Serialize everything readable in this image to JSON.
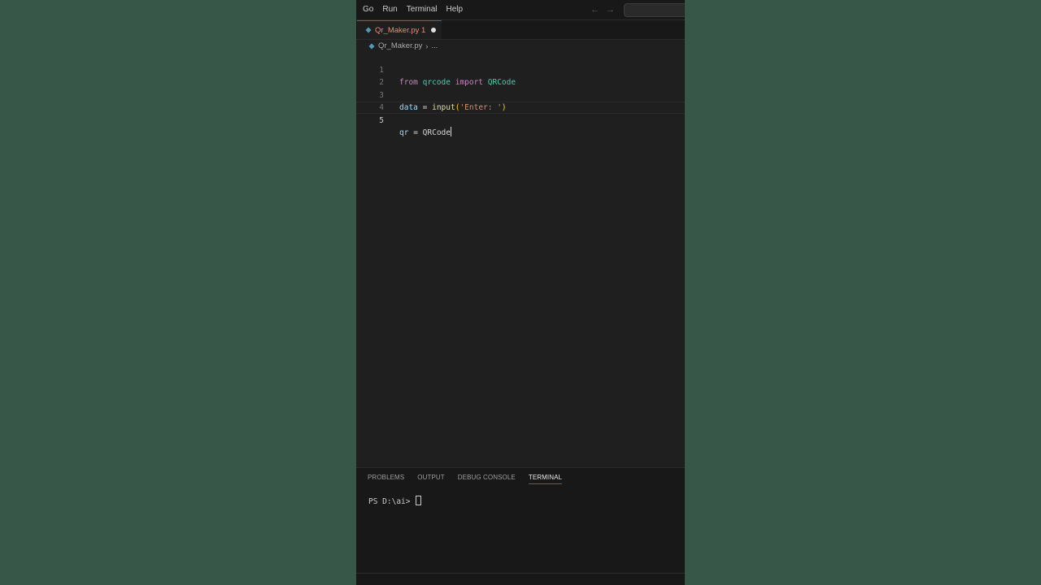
{
  "menu": [
    "Go",
    "Run",
    "Terminal",
    "Help"
  ],
  "tab": {
    "label": "Qr_Maker.py 1",
    "modified": true
  },
  "breadcrumb": {
    "file": "Qr_Maker.py",
    "more": "..."
  },
  "editor": {
    "line_numbers": [
      "1",
      "2",
      "3",
      "4",
      "5"
    ],
    "active_line": 5,
    "code": {
      "l1": {
        "kw_from": "from",
        "module": "qrcode",
        "kw_import": "import",
        "cls": "QRCode"
      },
      "l3": {
        "var": "data",
        "op": "=",
        "fn": "input",
        "open": "(",
        "str": "'Enter: '",
        "close": ")"
      },
      "l5": {
        "var": "qr",
        "op": "=",
        "ident": "QRCode"
      }
    }
  },
  "panel": {
    "tabs": [
      "PROBLEMS",
      "OUTPUT",
      "DEBUG CONSOLE",
      "TERMINAL"
    ],
    "active_tab": "TERMINAL",
    "terminal_prompt": "PS D:\\ai> "
  },
  "colors": {
    "background": "#375849",
    "editor_bg": "#1f1f1f",
    "accent": "#0078d4",
    "tab_modified_label": "#f48771"
  }
}
